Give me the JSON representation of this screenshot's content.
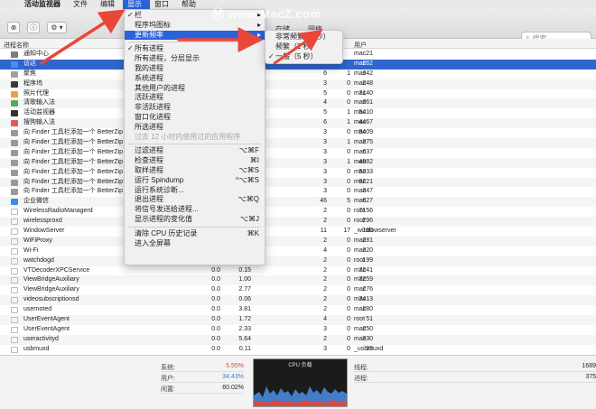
{
  "menubar": {
    "apple_icon": "apple-icon",
    "items": [
      "活动监视器",
      "文件",
      "编辑",
      "显示",
      "窗口",
      "帮助"
    ]
  },
  "toolbar": {
    "tab_visible": [
      "存储",
      "网络"
    ],
    "search_placeholder": "搜索",
    "close_btn": "⊗",
    "info_btn": "ⓘ",
    "gear_btn": "⚙ ▾"
  },
  "table": {
    "header": {
      "name": "进程名称",
      "user": "用户"
    },
    "rows": [
      {
        "name": "通知中心",
        "cpu": "",
        "time": "",
        "thr": "",
        "wake": "",
        "pid": "21",
        "user": "mac"
      },
      {
        "name": "访达",
        "cpu": "",
        "time": "",
        "thr": "",
        "wake": "",
        "pid": "262",
        "user": "mac",
        "selected": true
      },
      {
        "name": "聚焦",
        "cpu": "",
        "time": "",
        "thr": "6",
        "wake": "1",
        "pid": "342",
        "user": "mac"
      },
      {
        "name": "程序坞",
        "cpu": "",
        "time": "",
        "thr": "3",
        "wake": "0",
        "pid": "248",
        "user": "mac"
      },
      {
        "name": "照片代理",
        "cpu": "",
        "time": "",
        "thr": "5",
        "wake": "0",
        "pid": "7140",
        "user": "mac"
      },
      {
        "name": "清歌输入法",
        "cpu": "",
        "time": "",
        "thr": "4",
        "wake": "0",
        "pid": "361",
        "user": "mac"
      },
      {
        "name": "活动监视器",
        "cpu": "",
        "time": "",
        "thr": "5",
        "wake": "1",
        "pid": "9410",
        "user": "mac"
      },
      {
        "name": "搜狗输入法",
        "cpu": "",
        "time": "",
        "thr": "6",
        "wake": "1",
        "pid": "4467",
        "user": "mac"
      },
      {
        "name": "向 Finder 工具栏添加一个 BetterZip",
        "cpu": "",
        "time": "",
        "thr": "3",
        "wake": "0",
        "pid": "9409",
        "user": "mac"
      },
      {
        "name": "向 Finder 工具栏添加一个 BetterZip",
        "cpu": "",
        "time": "",
        "thr": "3",
        "wake": "1",
        "pid": "375",
        "user": "mac"
      },
      {
        "name": "向 Finder 工具栏添加一个 BetterZip",
        "cpu": "",
        "time": "",
        "thr": "3",
        "wake": "0",
        "pid": "637",
        "user": "mac"
      },
      {
        "name": "向 Finder 工具栏添加一个 BetterZip",
        "cpu": "",
        "time": "",
        "thr": "3",
        "wake": "1",
        "pid": "4982",
        "user": "mac"
      },
      {
        "name": "向 Finder 工具栏添加一个 BetterZip",
        "cpu": "",
        "time": "",
        "thr": "3",
        "wake": "0",
        "pid": "5333",
        "user": "mac"
      },
      {
        "name": "向 Finder 工具栏添加一个 BetterZip",
        "cpu": "",
        "time": "",
        "thr": "3",
        "wake": "0",
        "pid": "9221",
        "user": "mac"
      },
      {
        "name": "向 Finder 工具栏添加一个 BetterZip",
        "cpu": "",
        "time": "",
        "thr": "3",
        "wake": "0",
        "pid": "347",
        "user": "mac"
      },
      {
        "name": "企业微信",
        "cpu": "",
        "time": "",
        "thr": "46",
        "wake": "5",
        "pid": "627",
        "user": "mac"
      },
      {
        "name": "WirelessRadioManagerd",
        "cpu": "",
        "time": "",
        "thr": "2",
        "wake": "0",
        "pid": "7156",
        "user": "root"
      },
      {
        "name": "wirelessproxd",
        "cpu": "",
        "time": "",
        "thr": "2",
        "wake": "0",
        "pid": "296",
        "user": "root"
      },
      {
        "name": "WindowServer",
        "cpu": "",
        "time": "",
        "thr": "11",
        "wake": "17",
        "pid": "190",
        "user": "_windowserver"
      },
      {
        "name": "WiFiProxy",
        "cpu": "",
        "time": "",
        "thr": "2",
        "wake": "0",
        "pid": "281",
        "user": "mac"
      },
      {
        "name": "Wi-Fi",
        "cpu": "",
        "time": "",
        "thr": "4",
        "wake": "0",
        "pid": "320",
        "user": "mac"
      },
      {
        "name": "watchdogd",
        "cpu": "",
        "time": "",
        "thr": "2",
        "wake": "0",
        "pid": "199",
        "user": "root"
      },
      {
        "name": "VTDecoderXPCService",
        "cpu": "0.0",
        "time": "0.15",
        "thr": "2",
        "wake": "0",
        "pid": "7241",
        "user": "mac"
      },
      {
        "name": "ViewBridgeAuxiliary",
        "cpu": "0.0",
        "time": "1.00",
        "thr": "2",
        "wake": "0",
        "pid": "7259",
        "user": "mac"
      },
      {
        "name": "ViewBridgeAuxiliary",
        "cpu": "0.0",
        "time": "2.77",
        "thr": "2",
        "wake": "0",
        "pid": "276",
        "user": "mac"
      },
      {
        "name": "videosubscriptionsd",
        "cpu": "0.0",
        "time": "0.06",
        "thr": "2",
        "wake": "0",
        "pid": "7413",
        "user": "mac"
      },
      {
        "name": "usernoted",
        "cpu": "0.0",
        "time": "3.81",
        "thr": "2",
        "wake": "0",
        "pid": "280",
        "user": "mac"
      },
      {
        "name": "UserEventAgent",
        "cpu": "0.0",
        "time": "1.72",
        "thr": "4",
        "wake": "0",
        "pid": "51",
        "user": "root"
      },
      {
        "name": "UserEventAgent",
        "cpu": "0.0",
        "time": "2.33",
        "thr": "3",
        "wake": "0",
        "pid": "250",
        "user": "mac"
      },
      {
        "name": "useractivityd",
        "cpu": "0.0",
        "time": "5.64",
        "thr": "2",
        "wake": "0",
        "pid": "330",
        "user": "mac"
      },
      {
        "name": "usbmuxd",
        "cpu": "0.0",
        "time": "0.11",
        "thr": "3",
        "wake": "0",
        "pid": "93",
        "user": "_usbmuxd"
      }
    ]
  },
  "bottom": {
    "system_label": "系统:",
    "system_val": "5.55%",
    "user_label": "用户:",
    "user_val": "34.43%",
    "idle_label": "闲置:",
    "idle_val": "60.02%",
    "graph_title": "CPU 负载",
    "threads_label": "线程:",
    "threads_val": "1689",
    "proc_label": "进程:",
    "proc_val": "375"
  },
  "display_menu": {
    "items": [
      {
        "label": "栏",
        "checked": true,
        "submenu": true
      },
      {
        "label": "程序坞图标",
        "submenu": true
      },
      {
        "label": "更新频率",
        "submenu": true,
        "highlighted": true
      },
      {
        "sep": true
      },
      {
        "label": "所有进程",
        "checked": true
      },
      {
        "label": "所有进程，分层显示"
      },
      {
        "label": "我的进程"
      },
      {
        "label": "系统进程"
      },
      {
        "label": "其他用户的进程"
      },
      {
        "label": "活跃进程"
      },
      {
        "label": "非活跃进程"
      },
      {
        "label": "窗口化进程"
      },
      {
        "label": "所选进程"
      },
      {
        "label": "过去 12 小时内使用过的应用程序",
        "disabled": true
      },
      {
        "sep": true
      },
      {
        "label": "过滤进程",
        "shortcut": "⌥⌘F"
      },
      {
        "label": "检查进程",
        "shortcut": "⌘I"
      },
      {
        "label": "取样进程",
        "shortcut": "⌥⌘S"
      },
      {
        "label": "运行 Spindump",
        "shortcut": "^⌥⌘S"
      },
      {
        "label": "运行系统诊断..."
      },
      {
        "label": "退出进程",
        "shortcut": "⌥⌘Q"
      },
      {
        "label": "将信号发送给进程..."
      },
      {
        "label": "显示进程的变化值",
        "shortcut": "⌥⌘J"
      },
      {
        "sep": true
      },
      {
        "label": "清除 CPU 历史记录",
        "shortcut": "⌘K"
      },
      {
        "label": "进入全屏幕"
      }
    ]
  },
  "frequency_submenu": {
    "items": [
      {
        "label": "非常频繁（1秒）"
      },
      {
        "label": "频繁（2 秒）"
      },
      {
        "label": "一般（5 秒）",
        "checked": true
      }
    ]
  },
  "watermark": "www.MacZ.com",
  "colors": {
    "accent": "#2a62d9",
    "selected_row": "#2f65ce",
    "arrow": "#e8473a",
    "system": "#e0463b",
    "user": "#3a7fdc"
  }
}
